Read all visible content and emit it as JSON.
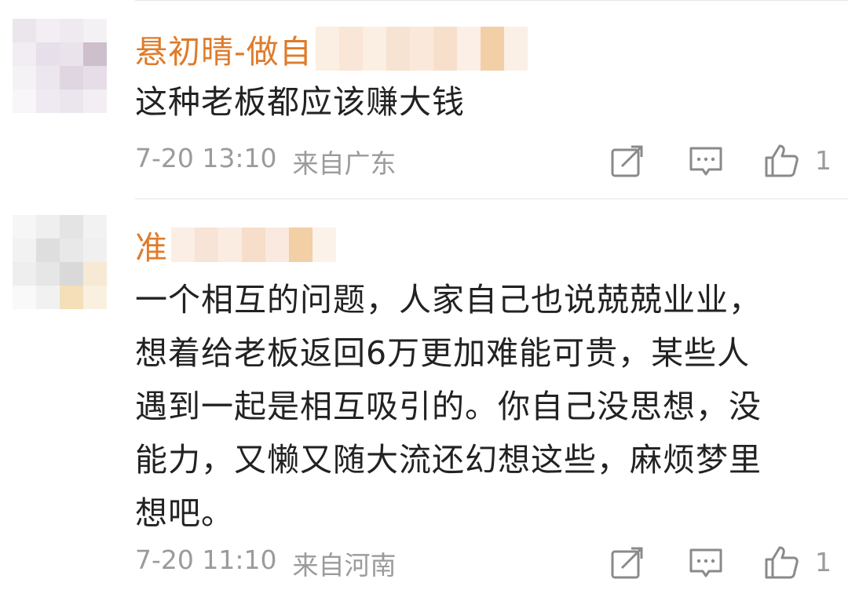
{
  "comments": [
    {
      "username": "悬初晴-做自",
      "lines": [
        "这种老板都应该赚大钱"
      ],
      "date": "7-20 13:10",
      "location": "来自广东",
      "like_count": "1",
      "icons": [
        "repost-icon",
        "comment-icon",
        "like-icon"
      ]
    },
    {
      "username": "准",
      "lines": [
        "一个相互的问题，人家自己也说兢兢业业，",
        "想着给老板返回6万更加难能可贵，某些人",
        "遇到一起是相互吸引的。你自己没思想，没",
        "能力，又懒又随大流还幻想这些，麻烦梦里",
        "想吧。"
      ],
      "date": "7-20 11:10",
      "location": "来自河南",
      "like_count": "1",
      "icons": [
        "repost-icon",
        "comment-icon",
        "like-icon"
      ]
    }
  ],
  "colors": {
    "username": "#e07b2a",
    "body_text": "#222222",
    "meta_text": "#9b9b9b",
    "divider": "#e6e6e6",
    "icon": "#8a8a8a"
  }
}
